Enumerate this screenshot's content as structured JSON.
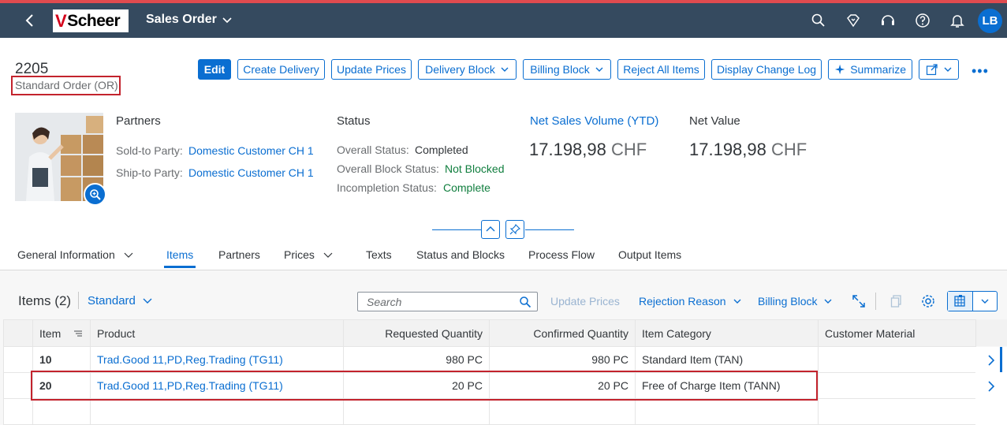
{
  "shell": {
    "logo_text": "Scheer",
    "app_title": "Sales Order",
    "avatar_initials": "LB",
    "icons": [
      "back-icon",
      "search-icon",
      "diamond-icon",
      "headset-icon",
      "help-icon",
      "bell-icon"
    ]
  },
  "header": {
    "object_number": "2205",
    "object_subtitle": "Standard Order (OR)",
    "actions": {
      "edit": "Edit",
      "create_delivery": "Create Delivery",
      "update_prices": "Update Prices",
      "delivery_block": "Delivery Block",
      "billing_block": "Billing Block",
      "reject_all": "Reject All Items",
      "display_change_log": "Display Change Log",
      "summarize": "Summarize"
    }
  },
  "partners": {
    "title": "Partners",
    "sold_to_label": "Sold-to Party:",
    "sold_to_value": "Domestic Customer CH 1",
    "ship_to_label": "Ship-to Party:",
    "ship_to_value": "Domestic Customer CH 1"
  },
  "status": {
    "title": "Status",
    "overall_label": "Overall Status:",
    "overall_value": "Completed",
    "block_label": "Overall Block Status:",
    "block_value": "Not Blocked",
    "incompletion_label": "Incompletion Status:",
    "incompletion_value": "Complete"
  },
  "kpis": {
    "net_sales_title": "Net Sales Volume (YTD)",
    "net_sales_value": "17.198,98",
    "net_sales_unit": "CHF",
    "net_value_title": "Net Value",
    "net_value_value": "17.198,98",
    "net_value_unit": "CHF"
  },
  "tabs": {
    "general": "General Information",
    "items": "Items",
    "partners": "Partners",
    "prices": "Prices",
    "texts": "Texts",
    "status_blocks": "Status and Blocks",
    "process_flow": "Process Flow",
    "output_items": "Output Items",
    "active": "Items"
  },
  "items_table": {
    "title": "Items (2)",
    "variant": "Standard",
    "search_placeholder": "Search",
    "update_prices": "Update Prices",
    "rejection_reason": "Rejection Reason",
    "billing_block": "Billing Block",
    "columns": {
      "item": "Item",
      "product": "Product",
      "requested_qty": "Requested Quantity",
      "confirmed_qty": "Confirmed Quantity",
      "item_category": "Item Category",
      "customer_material": "Customer Material"
    },
    "rows": [
      {
        "item": "10",
        "product": "Trad.Good 11,PD,Reg.Trading (TG11)",
        "requested": "980 PC",
        "confirmed": "980 PC",
        "category": "Standard Item (TAN)",
        "customer_material": ""
      },
      {
        "item": "20",
        "product": "Trad.Good 11,PD,Reg.Trading (TG11)",
        "requested": "20 PC",
        "confirmed": "20 PC",
        "category": "Free of Charge Item (TANN)",
        "customer_material": ""
      }
    ]
  },
  "colors": {
    "shell": "#354a5f",
    "accent": "#0a6ed1",
    "highlight_box": "#c3232d",
    "positive": "#107e3e"
  }
}
